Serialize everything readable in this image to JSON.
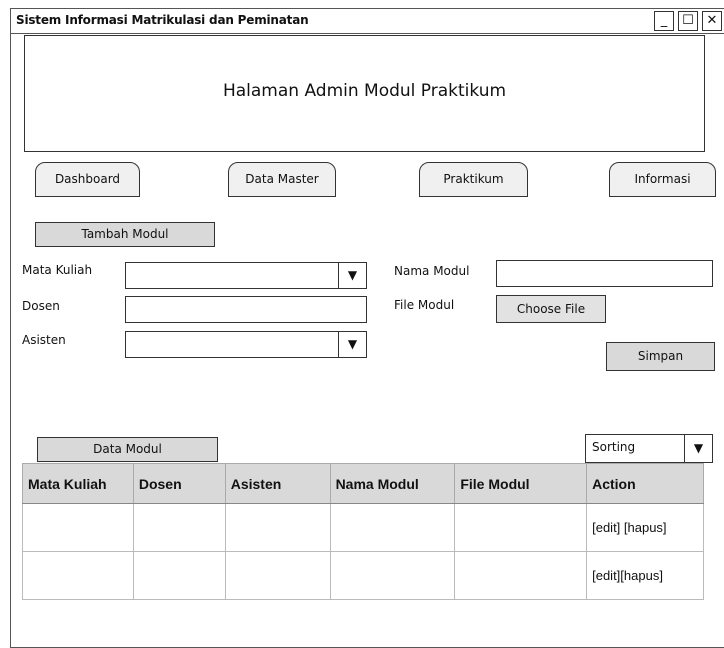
{
  "window": {
    "title": "Sistem Informasi Matrikulasi dan Peminatan",
    "controls": {
      "minimize": "_",
      "maximize": "☐",
      "close": "✕"
    }
  },
  "header": {
    "title": "Halaman Admin Modul Praktikum"
  },
  "nav": {
    "dashboard": "Dashboard",
    "data_master": "Data Master",
    "praktikum": "Praktikum",
    "informasi": "Informasi"
  },
  "form": {
    "section_label": "Tambah Modul",
    "mata_kuliah_label": "Mata Kuliah",
    "dosen_label": "Dosen",
    "asisten_label": "Asisten",
    "nama_modul_label": "Nama Modul",
    "file_modul_label": "File Modul",
    "choose_file_label": "Choose File",
    "save_label": "Simpan",
    "dropdown_arrow": "▼"
  },
  "data_section": {
    "label": "Data Modul",
    "sorting_value": "Sorting"
  },
  "table": {
    "headers": {
      "mata_kuliah": "Mata Kuliah",
      "dosen": "Dosen",
      "asisten": "Asisten",
      "nama_modul": "Nama Modul",
      "file_modul": "File Modul",
      "action": "Action"
    },
    "rows": [
      {
        "mata_kuliah": "",
        "dosen": "",
        "asisten": "",
        "nama_modul": "",
        "file_modul": "",
        "action": "[edit] [hapus]"
      },
      {
        "mata_kuliah": "",
        "dosen": "",
        "asisten": "",
        "nama_modul": "",
        "file_modul": "",
        "action": "[edit][hapus]"
      }
    ]
  }
}
